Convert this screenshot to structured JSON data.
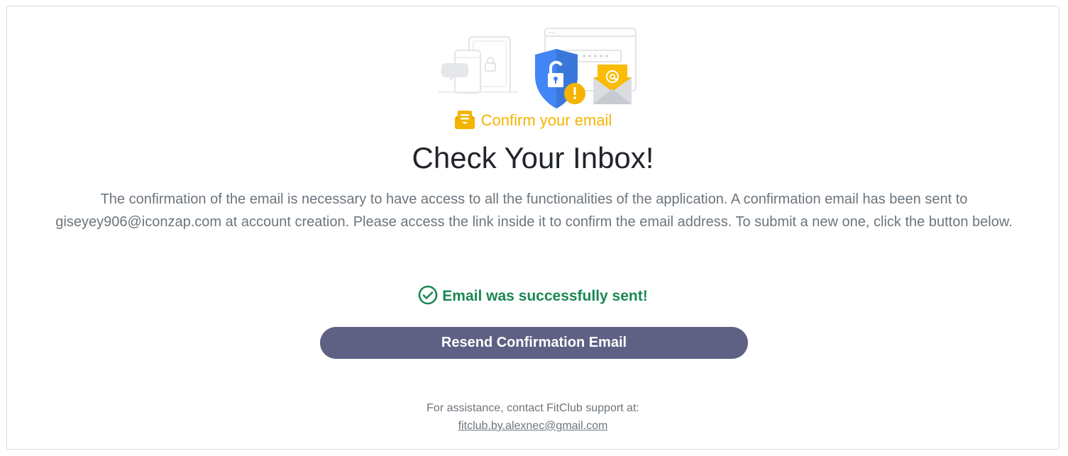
{
  "header": {
    "confirm_label": "Confirm your email",
    "title": "Check Your Inbox!"
  },
  "description": {
    "text": "The confirmation of the email is necessary to have access to all the functionalities of the application. A confirmation email has been sent to giseyey906@iconzap.com at account creation. Please access the link inside it to confirm the email address. To submit a new one, click the button below."
  },
  "status": {
    "success_message": "Email was successfully sent!"
  },
  "actions": {
    "resend_label": "Resend Confirmation Email"
  },
  "support": {
    "text": "For assistance, contact FitClub support at:",
    "email": "fitclub.by.alexnec@gmail.com"
  },
  "colors": {
    "accent_yellow": "#f4b400",
    "success_green": "#198754",
    "button_bg": "#5e6084",
    "shield_blue": "#4285f4"
  },
  "icons": {
    "illustration": "email-security-illustration",
    "confirm": "envelope-letter-icon",
    "success": "check-circle-icon"
  }
}
